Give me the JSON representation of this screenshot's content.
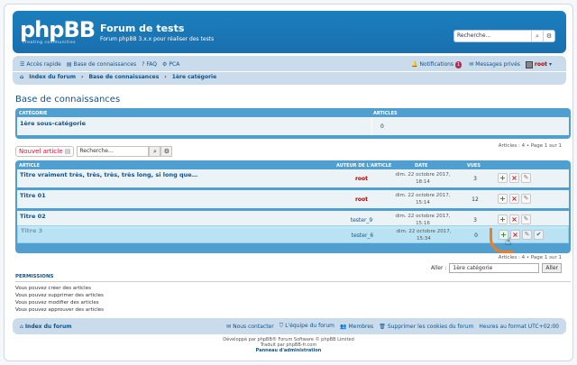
{
  "header": {
    "logo": "phpBB",
    "logo_sub": "creating communities",
    "title": "Forum de tests",
    "desc": "Forum phpBB 3.x.x pour réaliser des tests",
    "search_placeholder": "Recherche…"
  },
  "nav": {
    "quick": "Accès rapide",
    "kb": "Base de connaissances",
    "faq": "FAQ",
    "pca": "PCA",
    "notifications": "Notifications",
    "notif_count": "1",
    "messages": "Messages privés",
    "user": "root",
    "crumbs": [
      "Index du forum",
      "Base de connaissances",
      "1ère catégorie"
    ]
  },
  "page_title": "Base de connaissances",
  "category_table": {
    "col_category": "CATÉGORIE",
    "col_articles": "ARTICLES",
    "row_name": "1ère sous-catégorie",
    "row_count": "0"
  },
  "pagination": "Articles : 4 • Page 1 sur 1",
  "actions": {
    "new_article": "Nouvel article",
    "search_placeholder": "Recherche…"
  },
  "topic_table": {
    "col_article": "ARTICLE",
    "col_author": "AUTEUR DE L'ARTICLE",
    "col_date": "DATE",
    "col_views": "VUES",
    "rows": [
      {
        "title": "Titre vraiment très, très, très, très long, si long que…",
        "author": "root",
        "date1": "dim. 22 octobre 2017,",
        "date2": "18:14",
        "views": "3"
      },
      {
        "title": "Titre 01",
        "author": "root",
        "date1": "dim. 22 octobre 2017,",
        "date2": "15:14",
        "views": "12"
      },
      {
        "title": "Titre 02",
        "author": "tester_9",
        "date1": "dim. 22 octobre 2017,",
        "date2": "15:16",
        "views": "3"
      },
      {
        "title": "Titre 3",
        "author": "tester_6",
        "date1": "dim. 22 octobre 2017,",
        "date2": "15:34",
        "views": "0"
      }
    ]
  },
  "jump": {
    "label": "Aller :",
    "selected": "1ère catégorie",
    "button": "Aller"
  },
  "permissions": {
    "title": "PERMISSIONS",
    "lines": [
      "Vous pouvez créer des articles",
      "Vous pouvez supprimer des articles",
      "Vous pouvez modifier des articles",
      "Vous pouvez approuver des articles"
    ]
  },
  "footer": {
    "index": "Index du forum",
    "contact": "Nous contacter",
    "team": "L'équipe du forum",
    "members": "Membres",
    "cookies": "Supprimer les cookies du forum",
    "tz": "Heures au format UTC+02:00"
  },
  "credits": [
    "Développé par phpBB® Forum Software © phpBB Limited",
    "Traduit par phpBB-fr.com",
    "Panneau d'administration"
  ],
  "colors": {
    "header": "#1a76b6",
    "navbar": "#cadceb",
    "link": "#105289",
    "author_red": "#aa0000"
  }
}
